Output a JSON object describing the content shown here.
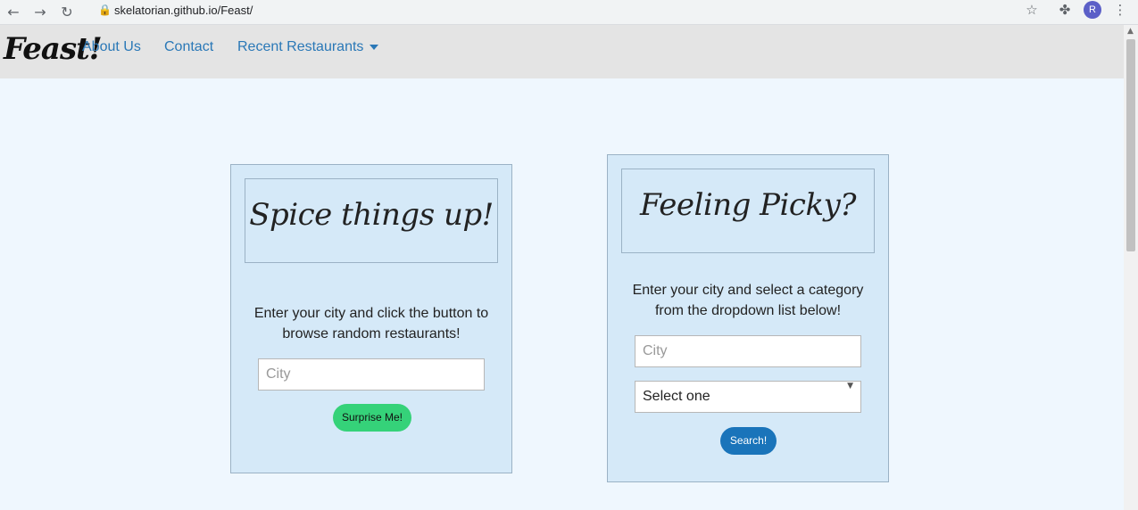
{
  "browser": {
    "url": "skelatorian.github.io/Feast/",
    "avatar_letter": "R"
  },
  "nav": {
    "brand": "Feast!",
    "links": [
      "About Us",
      "Contact",
      "Recent Restaurants"
    ]
  },
  "cards": {
    "random": {
      "title": "Spice things up!",
      "description": "Enter your city and click the button to browse random restaurants!",
      "city_placeholder": "City",
      "button": "Surprise Me!"
    },
    "picky": {
      "title": "Feeling Picky?",
      "description": "Enter your city and select a category from the dropdown list below!",
      "city_placeholder": "City",
      "category_selected": "Select one",
      "button": "Search!"
    }
  },
  "colors": {
    "nav_link": "#2a78b7",
    "surprise_button": "#35d279",
    "search_button": "#1a74ba",
    "card_background": "#d5e9f8",
    "page_background": "#eff7fe"
  },
  "icons": [
    "back-arrow-icon",
    "forward-arrow-icon",
    "reload-icon",
    "lock-icon",
    "star-icon",
    "puzzle-piece-icon",
    "menu-dots-icon",
    "caret-down-icon"
  ]
}
